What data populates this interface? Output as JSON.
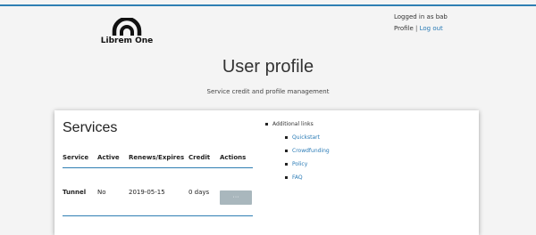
{
  "header": {
    "logo_text": "Librem One",
    "logged_in_text": "Logged in as bab",
    "profile_label": "Profile",
    "separator": "|",
    "logout_label": "Log out"
  },
  "page": {
    "title": "User profile",
    "subtitle": "Service credit and profile management"
  },
  "services": {
    "title": "Services",
    "columns": [
      "Service",
      "Active",
      "Renews/Expires",
      "Credit",
      "Actions"
    ],
    "rows": [
      {
        "service": "Tunnel",
        "active": "No",
        "renews_expires": "2019-05-15",
        "credit": "0 days",
        "action_label": "···"
      }
    ]
  },
  "links": {
    "heading": "Additional links",
    "items": [
      "Quickstart",
      "Crowdfunding",
      "Policy",
      "FAQ"
    ]
  },
  "colors": {
    "accent": "#2f7fb3",
    "link": "#2a7bb6",
    "button": "#a9b7bd",
    "background": "#f4f4f4"
  },
  "icons": {
    "logo": "librem-arch-logo-icon"
  }
}
